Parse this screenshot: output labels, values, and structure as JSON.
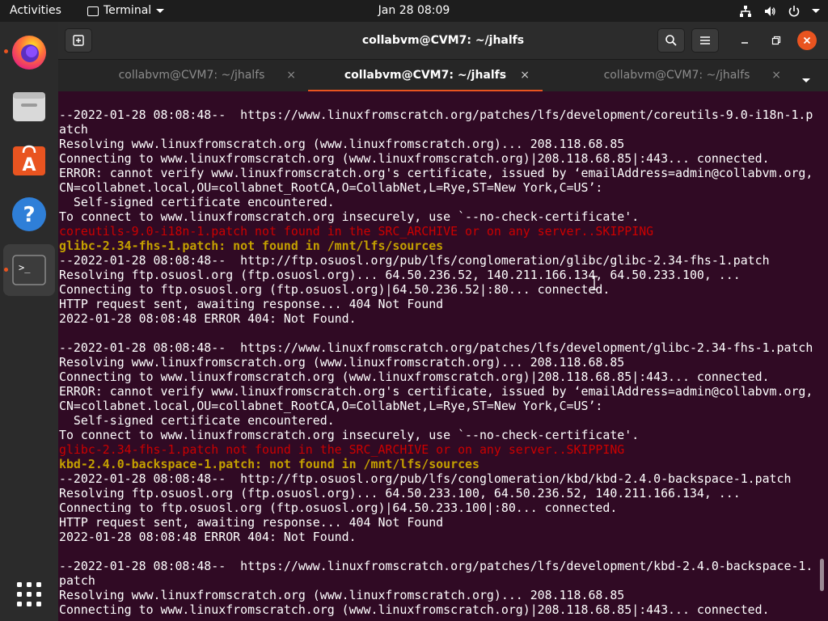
{
  "topbar": {
    "activities": "Activities",
    "app_menu": "Terminal",
    "clock": "Jan 28  08:09"
  },
  "dock": {
    "apps": [
      "firefox-icon",
      "files-icon",
      "software-icon",
      "help-icon",
      "terminal-icon",
      "show-apps-icon"
    ]
  },
  "window": {
    "title": "collabvm@CVM7: ~/jhalfs",
    "tabs": [
      {
        "label": "collabvm@CVM7: ~/jhalfs",
        "close": "×"
      },
      {
        "label": "collabvm@CVM7: ~/jhalfs",
        "close": "×"
      },
      {
        "label": "collabvm@CVM7: ~/jhalfs",
        "close": "×"
      }
    ]
  },
  "terminal": {
    "lines": [
      {
        "text": "--2022-01-28 08:08:48--  https://www.linuxfromscratch.org/patches/lfs/development/coreutils-9.0-i18n-1.p",
        "style": "normal"
      },
      {
        "text": "atch",
        "style": "normal"
      },
      {
        "text": "Resolving www.linuxfromscratch.org (www.linuxfromscratch.org)... 208.118.68.85",
        "style": "normal"
      },
      {
        "text": "Connecting to www.linuxfromscratch.org (www.linuxfromscratch.org)|208.118.68.85|:443... connected.",
        "style": "normal"
      },
      {
        "text": "ERROR: cannot verify www.linuxfromscratch.org's certificate, issued by ‘emailAddress=admin@collabvm.org,",
        "style": "normal"
      },
      {
        "text": "CN=collabnet.local,OU=collabnet_RootCA,O=CollabNet,L=Rye,ST=New York,C=US’:",
        "style": "normal"
      },
      {
        "text": "  Self-signed certificate encountered.",
        "style": "normal"
      },
      {
        "text": "To connect to www.linuxfromscratch.org insecurely, use `--no-check-certificate'.",
        "style": "normal"
      },
      {
        "text": "coreutils-9.0-i18n-1.patch not found in the SRC_ARCHIVE or on any server..SKIPPING",
        "style": "red"
      },
      {
        "text": "glibc-2.34-fhs-1.patch: not found in /mnt/lfs/sources",
        "style": "yellow"
      },
      {
        "text": "--2022-01-28 08:08:48--  http://ftp.osuosl.org/pub/lfs/conglomeration/glibc/glibc-2.34-fhs-1.patch",
        "style": "normal"
      },
      {
        "text": "Resolving ftp.osuosl.org (ftp.osuosl.org)... 64.50.236.52, 140.211.166.134, 64.50.233.100, ...",
        "style": "normal"
      },
      {
        "text": "Connecting to ftp.osuosl.org (ftp.osuosl.org)|64.50.236.52|:80... connected.",
        "style": "normal"
      },
      {
        "text": "HTTP request sent, awaiting response... 404 Not Found",
        "style": "normal"
      },
      {
        "text": "2022-01-28 08:08:48 ERROR 404: Not Found.",
        "style": "normal"
      },
      {
        "text": "",
        "style": "normal"
      },
      {
        "text": "--2022-01-28 08:08:48--  https://www.linuxfromscratch.org/patches/lfs/development/glibc-2.34-fhs-1.patch",
        "style": "normal"
      },
      {
        "text": "Resolving www.linuxfromscratch.org (www.linuxfromscratch.org)... 208.118.68.85",
        "style": "normal"
      },
      {
        "text": "Connecting to www.linuxfromscratch.org (www.linuxfromscratch.org)|208.118.68.85|:443... connected.",
        "style": "normal"
      },
      {
        "text": "ERROR: cannot verify www.linuxfromscratch.org's certificate, issued by ‘emailAddress=admin@collabvm.org,",
        "style": "normal"
      },
      {
        "text": "CN=collabnet.local,OU=collabnet_RootCA,O=CollabNet,L=Rye,ST=New York,C=US’:",
        "style": "normal"
      },
      {
        "text": "  Self-signed certificate encountered.",
        "style": "normal"
      },
      {
        "text": "To connect to www.linuxfromscratch.org insecurely, use `--no-check-certificate'.",
        "style": "normal"
      },
      {
        "text": "glibc-2.34-fhs-1.patch not found in the SRC_ARCHIVE or on any server..SKIPPING",
        "style": "red"
      },
      {
        "text": "kbd-2.4.0-backspace-1.patch: not found in /mnt/lfs/sources",
        "style": "yellow"
      },
      {
        "text": "--2022-01-28 08:08:48--  http://ftp.osuosl.org/pub/lfs/conglomeration/kbd/kbd-2.4.0-backspace-1.patch",
        "style": "normal"
      },
      {
        "text": "Resolving ftp.osuosl.org (ftp.osuosl.org)... 64.50.233.100, 64.50.236.52, 140.211.166.134, ...",
        "style": "normal"
      },
      {
        "text": "Connecting to ftp.osuosl.org (ftp.osuosl.org)|64.50.233.100|:80... connected.",
        "style": "normal"
      },
      {
        "text": "HTTP request sent, awaiting response... 404 Not Found",
        "style": "normal"
      },
      {
        "text": "2022-01-28 08:08:48 ERROR 404: Not Found.",
        "style": "normal"
      },
      {
        "text": "",
        "style": "normal"
      },
      {
        "text": "--2022-01-28 08:08:48--  https://www.linuxfromscratch.org/patches/lfs/development/kbd-2.4.0-backspace-1.",
        "style": "normal"
      },
      {
        "text": "patch",
        "style": "normal"
      },
      {
        "text": "Resolving www.linuxfromscratch.org (www.linuxfromscratch.org)... 208.118.68.85",
        "style": "normal"
      },
      {
        "text": "Connecting to www.linuxfromscratch.org (www.linuxfromscratch.org)|208.118.68.85|:443... connected.",
        "style": "normal"
      }
    ]
  },
  "colors": {
    "desktop_bg": "#2c001e",
    "terminal_bg": "#300a24",
    "accent": "#e95420",
    "error_text": "#cc0000",
    "warning_text": "#c4a000"
  }
}
